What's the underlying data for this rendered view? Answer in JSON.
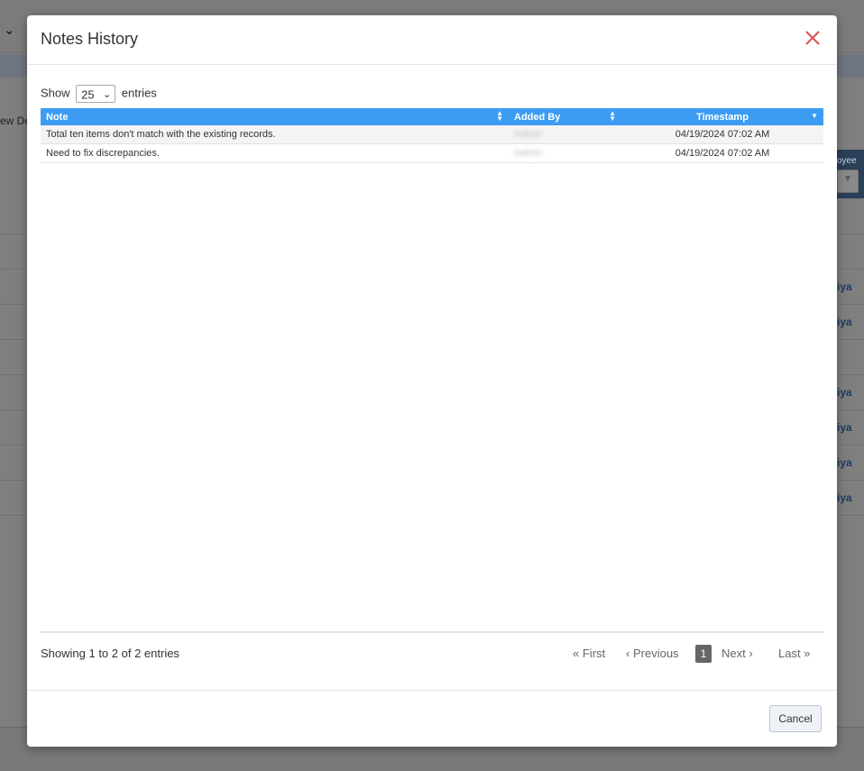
{
  "background": {
    "view_link": "ew De",
    "column_header": "oyee",
    "row_names": [
      "iya",
      "iya",
      "iya",
      "iya",
      "iya",
      "iya"
    ]
  },
  "modal": {
    "title": "Notes History",
    "close_icon": "close-icon",
    "length": {
      "show_label": "Show",
      "value": "25",
      "entries_label": "entries"
    },
    "table": {
      "columns": [
        "Note",
        "Added By",
        "Timestamp"
      ],
      "rows": [
        {
          "note": "Total ten items don't match with the existing records.",
          "added_by": "Admin",
          "timestamp": "04/19/2024 07:02 AM"
        },
        {
          "note": "Need to fix discrepancies.",
          "added_by": "Admin",
          "timestamp": "04/19/2024 07:02 AM"
        }
      ]
    },
    "info": "Showing 1 to 2 of 2 entries",
    "pagination": {
      "first": "First",
      "previous": "Previous",
      "current": "1",
      "next": "Next",
      "last": "Last"
    },
    "cancel_label": "Cancel"
  },
  "colors": {
    "header_bg": "#3c9cf2",
    "close": "#d9534f",
    "current_page_bg": "#666666"
  }
}
